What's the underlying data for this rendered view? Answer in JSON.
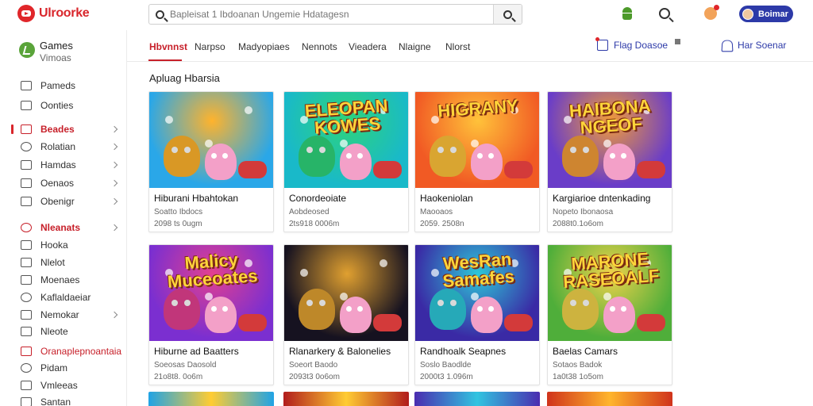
{
  "header": {
    "logo_text": "Ulroorke",
    "search_placeholder": "Bapleisat 1 Ibdoanan Ungemie Hdatagesn",
    "signin_label": "Boimar"
  },
  "sidebar": {
    "head_title": "Games",
    "head_subtitle": "Vimoas",
    "items": [
      {
        "label": "Pameds",
        "chevron": false
      },
      {
        "label": "Oonties",
        "chevron": false
      },
      {
        "label": "Beades",
        "chevron": true,
        "active": true
      },
      {
        "label": "Rolatian",
        "chevron": true
      },
      {
        "label": "Hamdas",
        "chevron": true
      },
      {
        "label": "Oenaos",
        "chevron": true
      },
      {
        "label": "Obenigr",
        "chevron": true
      },
      {
        "label": "Nleanats",
        "chevron": true,
        "active": true
      },
      {
        "label": "Hooka",
        "chevron": false
      },
      {
        "label": "Nlelot",
        "chevron": false
      },
      {
        "label": "Moenaes",
        "chevron": false
      },
      {
        "label": "Kaflaldaeiar",
        "chevron": false
      },
      {
        "label": "Nemokar",
        "chevron": true
      },
      {
        "label": "Nleote",
        "chevron": false
      },
      {
        "label": "Oranaplepnoantaia",
        "chevron": false,
        "accent": true
      },
      {
        "label": "Pidam",
        "chevron": false
      },
      {
        "label": "Vmleeas",
        "chevron": false
      },
      {
        "label": "Santan",
        "chevron": false
      }
    ]
  },
  "tabs": {
    "items": [
      "Hbvnnst",
      "Narpso",
      "Madyopiaes",
      "Nennots",
      "Vieadera",
      "Nlaigne",
      "Nlorst"
    ],
    "right_1": "Flag Doasoe",
    "right_2": "Har Soenar"
  },
  "section_title": "Apluag Hbarsia",
  "cards": [
    {
      "title": "Hiburani Hbahtokan",
      "meta1": "Soatto Ibdocs",
      "meta2": "2098 ts 0ugm",
      "banner": "",
      "colors": [
        "#2aa7e8",
        "#ffb32c"
      ]
    },
    {
      "title": "Conordeoiate",
      "meta1": "Aobdeosed",
      "meta2": "2ts918 0006m",
      "banner": "ELEOPAN KOWES",
      "colors": [
        "#19b9c9",
        "#2ed47a"
      ]
    },
    {
      "title": "Haokeniolan",
      "meta1": "Maooaos",
      "meta2": "2059. 2508n",
      "banner": "HIGRANY",
      "colors": [
        "#f15a24",
        "#ffc23a"
      ]
    },
    {
      "title": "Kargiarioe dntenkading",
      "meta1": "Nopeto Ibonaosa",
      "meta2": "2088t0.1o6om",
      "banner": "HAIBONA NGEOF",
      "colors": [
        "#6a3dc8",
        "#f29c38"
      ]
    },
    {
      "title": "Hiburne ad Baatters",
      "meta1": "Soeosas Daosold",
      "meta2": "21o8t8. 0o6m",
      "banner": "Malicy Muceoates",
      "colors": [
        "#7b2fd0",
        "#e3408f"
      ]
    },
    {
      "title": "Rlanarkery & Balonelies",
      "meta1": "Soeort Baodo",
      "meta2": "2093t3 0o6om",
      "banner": "",
      "colors": [
        "#161220",
        "#e0a030"
      ]
    },
    {
      "title": "Randhoalk Seapnes",
      "meta1": "Soslo Baodlde",
      "meta2": "2000t3 1.096m",
      "banner": "WesRan Samafes",
      "colors": [
        "#3a2aa5",
        "#2dc7d8"
      ]
    },
    {
      "title": "Baelas Camars",
      "meta1": "Sotaos Badok",
      "meta2": "1a0t38 1o5om",
      "banner": "MARONE RASEOALF",
      "colors": [
        "#4fae3a",
        "#f1d24a"
      ]
    }
  ],
  "peek_colors": [
    [
      "#20a3e5",
      "#ffcc33"
    ],
    [
      "#b11c1c",
      "#ffcc33"
    ],
    [
      "#4a2cb0",
      "#31c4e0"
    ],
    [
      "#d0331c",
      "#ffb52c"
    ]
  ]
}
